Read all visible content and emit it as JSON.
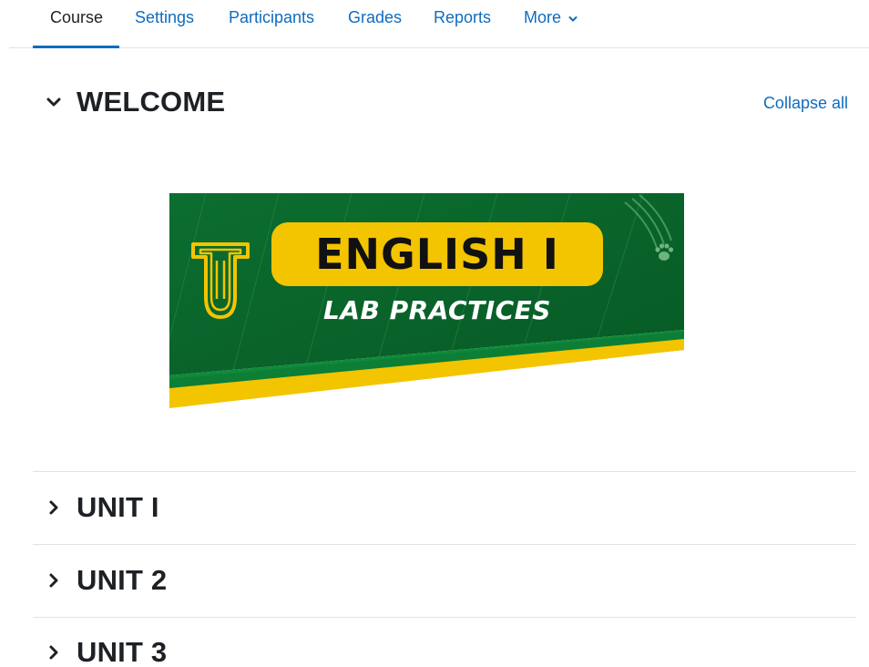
{
  "nav": {
    "tabs": [
      {
        "label": "Course",
        "active": true
      },
      {
        "label": "Settings",
        "active": false
      },
      {
        "label": "Participants",
        "active": false
      },
      {
        "label": "Grades",
        "active": false
      },
      {
        "label": "Reports",
        "active": false
      },
      {
        "label": "More",
        "active": false
      }
    ]
  },
  "course": {
    "collapse_all": "Collapse all",
    "sections": [
      {
        "title": "WELCOME",
        "expanded": true
      },
      {
        "title": "UNIT I",
        "expanded": false
      },
      {
        "title": "UNIT 2",
        "expanded": false
      },
      {
        "title": "UNIT 3",
        "expanded": false
      }
    ],
    "banner": {
      "title": "ENGLISH I",
      "subtitle": "LAB PRACTICES"
    }
  },
  "colors": {
    "link": "#0f6cbf",
    "text": "#1d2125",
    "banner_green": "#0b6b2e",
    "banner_yellow": "#f3c400"
  },
  "icons": {
    "expanded": "chevron-down-icon",
    "collapsed": "chevron-right-icon",
    "more": "chevron-down-icon"
  }
}
